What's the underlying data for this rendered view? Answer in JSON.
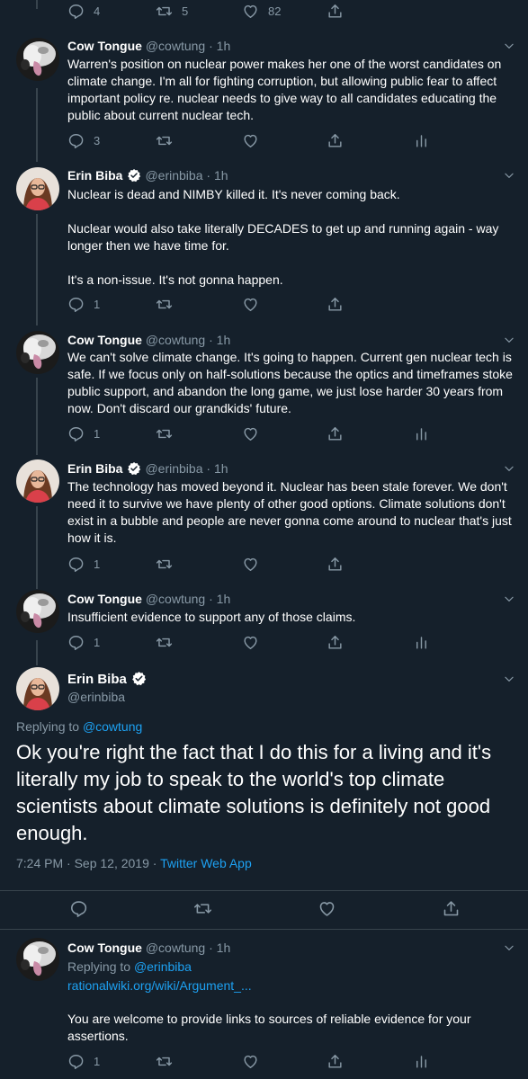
{
  "top_actions": {
    "replies": "4",
    "retweets": "5",
    "likes": "82"
  },
  "tweets": [
    {
      "name": "Cow Tongue",
      "handle": "@cowtung",
      "time": "1h",
      "text": "Warren's position on nuclear power makes her one of the worst candidates on climate change. I'm all for fighting corruption, but allowing public fear to affect important policy re. nuclear needs to give way to all candidates educating the public about current nuclear tech.",
      "replies": "3"
    },
    {
      "name": "Erin Biba",
      "handle": "@erinbiba",
      "time": "1h",
      "text": "Nuclear is dead and NIMBY killed it. It's never coming back.\n\nNuclear would also take literally DECADES to get up and running again - way longer then we have time for.\n\nIt's a non-issue. It's not gonna happen.",
      "replies": "1"
    },
    {
      "name": "Cow Tongue",
      "handle": "@cowtung",
      "time": "1h",
      "text": "We can't solve climate change. It's going to happen. Current gen nuclear tech is safe. If we focus only on half-solutions because the optics and timeframes stoke public support, and abandon the long game, we just lose harder 30 years from now. Don't discard our grandkids' future.",
      "replies": "1"
    },
    {
      "name": "Erin Biba",
      "handle": "@erinbiba",
      "time": "1h",
      "text": "The technology has moved beyond it. Nuclear has been stale forever. We don't need it to survive we have plenty of other good options. Climate solutions don't exist in a bubble and people are never gonna come around to nuclear that's just how it is.",
      "replies": "1"
    },
    {
      "name": "Cow Tongue",
      "handle": "@cowtung",
      "time": "1h",
      "text": "Insufficient evidence to support any of those claims.",
      "replies": "1"
    }
  ],
  "focused": {
    "name": "Erin Biba",
    "handle": "@erinbiba",
    "replying_label": "Replying to",
    "replying_to": "@cowtung",
    "text": "Ok you're right the fact that I do this for a living and it's literally my job to speak to the world's top climate scientists about climate solutions is definitely not good enough.",
    "timestamp": "7:24 PM · Sep 12, 2019 · ",
    "source": "Twitter Web App"
  },
  "last_reply": {
    "name": "Cow Tongue",
    "handle": "@cowtung",
    "time": "1h",
    "replying_label": "Replying to",
    "replying_to": "@erinbiba",
    "link": "rationalwiki.org/wiki/Argument_...",
    "text": "You are welcome to provide links to sources of reliable evidence for your assertions.",
    "replies": "1"
  },
  "colors": {
    "background": "#15202b",
    "muted": "#8899a6",
    "accent": "#1da1f2",
    "divider": "#38444d"
  }
}
